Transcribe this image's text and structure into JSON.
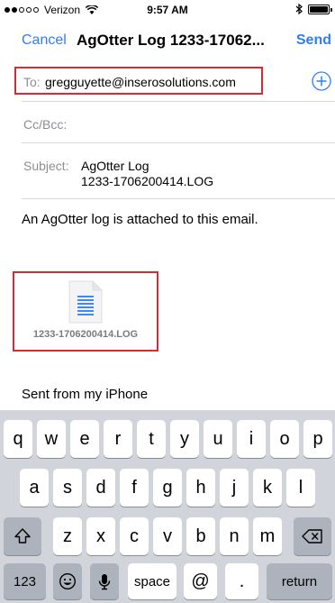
{
  "status_bar": {
    "carrier": "Verizon",
    "time": "9:57 AM",
    "signal_bars_filled": 2,
    "signal_bars_total": 5,
    "battery_level": 1.0,
    "icons": [
      "wifi-icon",
      "bluetooth-icon",
      "battery-icon"
    ]
  },
  "nav": {
    "cancel_label": "Cancel",
    "title": "AgOtter Log 1233-17062...",
    "send_label": "Send"
  },
  "fields": {
    "to_label": "To:",
    "to_value": "gregguyette@inserosolutions.com",
    "add_icon": "plus-circle-icon",
    "cc_label": "Cc/Bcc:",
    "subject_label": "Subject:",
    "subject_line1": "AgOtter Log",
    "subject_line2": "1233-1706200414.LOG"
  },
  "body": {
    "text": "An AgOtter log is attached to this email.",
    "attachment_name": "1233-1706200414.LOG",
    "attachment_icon": "document-icon",
    "signature": "Sent from my iPhone"
  },
  "keyboard": {
    "row1": [
      "q",
      "w",
      "e",
      "r",
      "t",
      "y",
      "u",
      "i",
      "o",
      "p"
    ],
    "row2": [
      "a",
      "s",
      "d",
      "f",
      "g",
      "h",
      "j",
      "k",
      "l"
    ],
    "row3": [
      "z",
      "x",
      "c",
      "v",
      "b",
      "n",
      "m"
    ],
    "numbers_label": "123",
    "space_label": "space",
    "at_label": "@",
    "period_label": ".",
    "return_label": "return",
    "icons": [
      "shift-icon",
      "delete-icon",
      "emoji-icon",
      "microphone-icon"
    ]
  },
  "colors": {
    "accent": "#2f7df6",
    "highlight": "#d12c38",
    "keyboard_bg": "#d1d4da",
    "dark_key": "#acb3bd"
  }
}
